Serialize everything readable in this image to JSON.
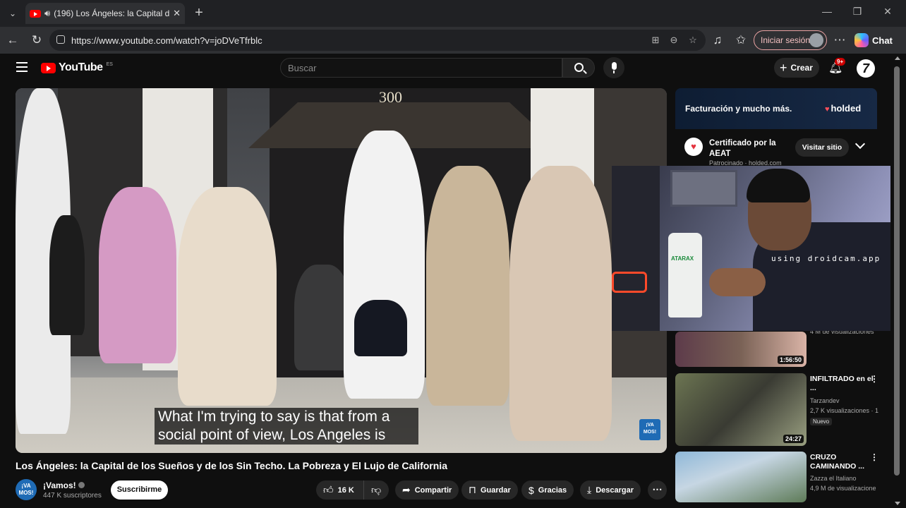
{
  "browser": {
    "tab_title": "(196) Los Ángeles: la Capital d",
    "url": "https://www.youtube.com/watch?v=joDVeTfrblc",
    "signin_label": "Iniciar sesión",
    "chat_label": "Chat"
  },
  "youtube": {
    "logo_text": "YouTube",
    "logo_region": "ES",
    "search_placeholder": "Buscar",
    "create_label": "Crear",
    "notifications_badge": "9+"
  },
  "video": {
    "marquee_number": "300",
    "caption_line1": "What I'm trying to say is that from a",
    "caption_line2": "social point of view, Los Angeles is",
    "watermark": "¡VA MOS!",
    "title": "Los Ángeles: la Capital de los Sueños y de los Sin Techo. La Pobreza y El Lujo de California",
    "channel_name": "¡Vamos!",
    "subscribers": "447 K suscriptores",
    "subscribe_label": "Suscribirme",
    "likes": "16 K",
    "share_label": "Compartir",
    "save_label": "Guardar",
    "thanks_label": "Gracias",
    "download_label": "Descargar"
  },
  "ad": {
    "banner_text": "Facturación y mucho más.",
    "brand": "holded",
    "title": "Certificado por la AEAT",
    "visit_label": "Visitar sitio",
    "sponsored": "Patrocinado · holded.com"
  },
  "webcam": {
    "watermark": "using droidcam.app",
    "bottle_label": "ATARAX"
  },
  "recommendations": [
    {
      "meta": "4 M de visualizaciones",
      "duration": "1:56:50"
    },
    {
      "title": "INFILTRADO en el ...",
      "channel": "Tarzandev",
      "meta": "2,7 K visualizaciones · 1",
      "badge": "Nuevo",
      "duration": "24:27"
    },
    {
      "title": "CRUZO CAMINANDO ...",
      "channel": "Zazza el Italiano",
      "meta": "4,9 M de visualizacione"
    }
  ],
  "colors": {
    "background": "#0f0f0f",
    "youtube_red": "#ff0000",
    "accent_signin": "#e9a2a2"
  }
}
